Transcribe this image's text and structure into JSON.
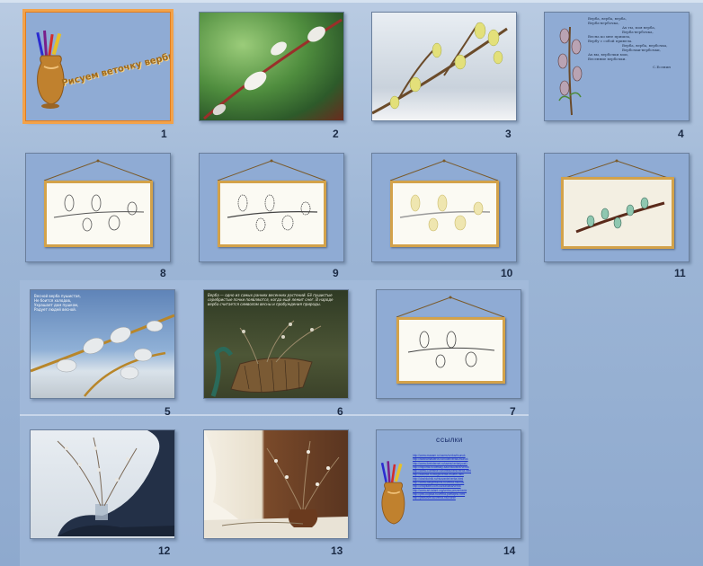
{
  "app": {
    "view": "Slide Sorter"
  },
  "selected_slide": 1,
  "slides": [
    {
      "number": "1",
      "title": "Рисуем веточку вербы"
    },
    {
      "number": "2"
    },
    {
      "number": "3"
    },
    {
      "number": "4",
      "poem": [
        "Верба, верба, верба,",
        "Верба-вербочка,",
        "Ах ты, моя верба,",
        "Верба-вербочка,",
        "Весна ко мне пришла,",
        "Вербу с собой привела.",
        "Верба, верба, вербочка,",
        "Вербочки-вербочки,",
        "Ах вы, вербочки мои,",
        "Весенние вербочки."
      ],
      "author": "С.Есенин"
    },
    {
      "number": "5",
      "text": [
        "Весной верба пушистая,",
        "Не боится холодов,",
        "Украшает дом пушком,",
        "Радует людей весной."
      ]
    },
    {
      "number": "6",
      "text": "Верба — одно из самых ранних весенних растений. Её пушистые серебристые почки появляются, когда ещё лежит снег. В народе верба считается символом весны и пробуждения природы."
    },
    {
      "number": "7"
    },
    {
      "number": "8"
    },
    {
      "number": "9"
    },
    {
      "number": "10"
    },
    {
      "number": "11"
    },
    {
      "number": "12"
    },
    {
      "number": "13"
    },
    {
      "number": "14",
      "links_title": "ССЫЛКИ",
      "links": [
        "http://www.maaam.ru/users/verba/risunok",
        "http://stranamasterov.ru/node/verba-risunok",
        "http://www.liveinternet.ru/users/verba/post1",
        "http://nsportal.ru/detskiy-sad/risovanie/verba",
        "http://www.o-detstve.ru/forteachers/verba.html",
        "http://kladraz.ru/blogs/verba-risuem.html",
        "http://doshkolnik.ru/risovanie/verba.html",
        "http://www.babylessons.ru/verba-risunok",
        "http://vospitatel.com.ua/zaniatia/verba",
        "http://www.art-talant.org/verba-prezentacia",
        "http://ped-kopilka.ru/verba-poetapno.html",
        "http://pedsovet.su/verba-risovanie"
      ]
    }
  ]
}
